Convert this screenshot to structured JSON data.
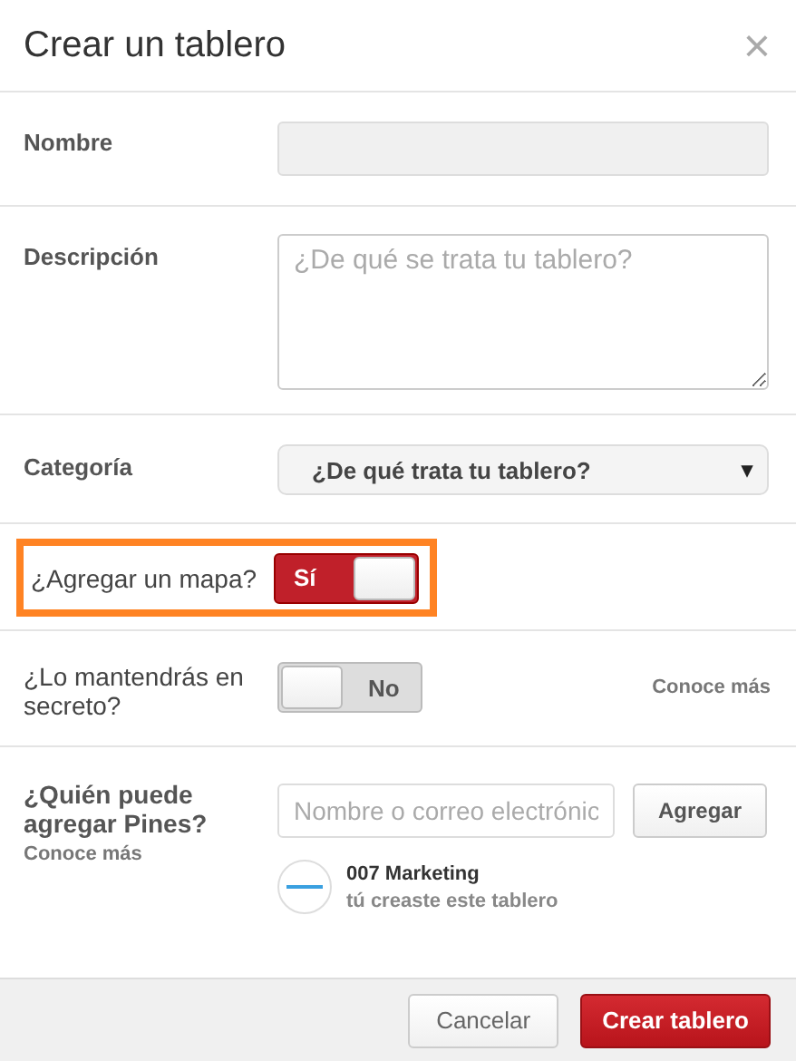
{
  "dialog": {
    "title": "Crear un tablero",
    "close": "×"
  },
  "name": {
    "label": "Nombre"
  },
  "description": {
    "label": "Descripción",
    "placeholder": "¿De qué se trata tu tablero?"
  },
  "category": {
    "label": "Categoría",
    "value": "¿De qué trata tu tablero?",
    "caret": "▾"
  },
  "map": {
    "label": "¿Agregar un mapa?",
    "toggle_text": "Sí",
    "on": true,
    "highlighted": true
  },
  "secret": {
    "label": "¿Lo mantendrás en secreto?",
    "toggle_text": "No",
    "on": false,
    "link": "Conoce más"
  },
  "collaborators": {
    "label": "¿Quién puede agregar Pines?",
    "link": "Conoce más",
    "placeholder": "Nombre o correo electrónic",
    "add_button": "Agregar",
    "owner_name": "007 Marketing",
    "owner_note": "tú creaste este tablero"
  },
  "buttons": {
    "cancel": "Cancelar",
    "create": "Crear tablero"
  }
}
